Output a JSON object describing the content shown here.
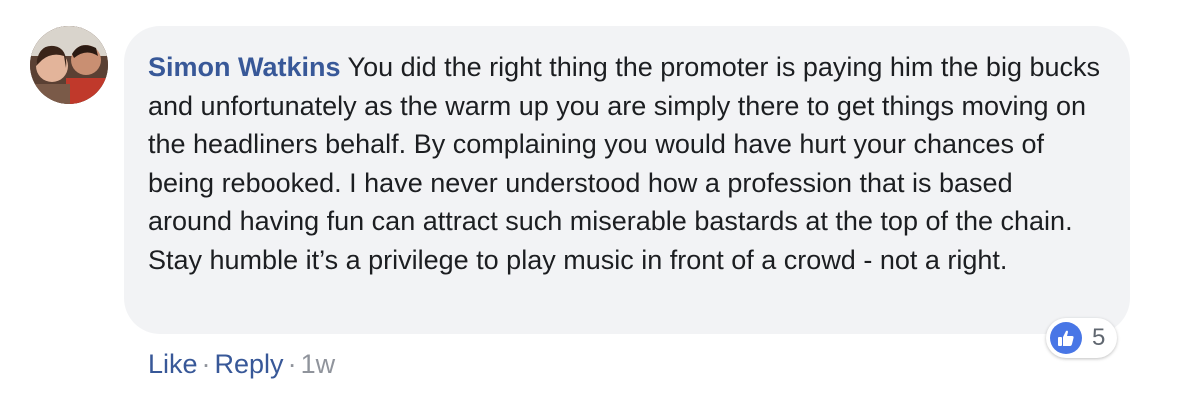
{
  "comment": {
    "author": "Simon Watkins",
    "text": "You did the right thing the promoter is paying him the big bucks and unfortunately as the warm up you are simply there to get things moving on the headliners behalf. By complaining you would have hurt your chances of being rebooked. I have never understood how a profession that is based around having fun can attract such miserable bastards at the top of the chain. Stay humble it’s a privilege to play music in front of a crowd - not a right.",
    "reaction_icon": "like-thumbs-up-icon",
    "reaction_count": "5"
  },
  "actions": {
    "like_label": "Like",
    "separator": "·",
    "reply_label": "Reply",
    "timestamp": "1w"
  },
  "colors": {
    "author_link": "#385898",
    "bubble_bg": "#f2f3f5",
    "like_blue": "#4876e6",
    "meta_gray": "#90949c"
  }
}
